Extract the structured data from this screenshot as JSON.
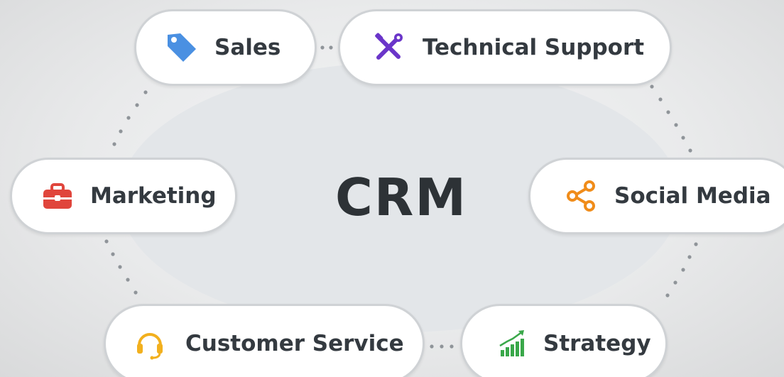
{
  "diagram": {
    "center": {
      "label": "CRM"
    },
    "nodes": [
      {
        "id": "sales",
        "label": "Sales",
        "icon": "tag-icon",
        "color": "#4a90e2"
      },
      {
        "id": "tech",
        "label": "Technical Support",
        "icon": "tools-icon",
        "color": "#6a35c9"
      },
      {
        "id": "marketing",
        "label": "Marketing",
        "icon": "briefcase-icon",
        "color": "#e0453c"
      },
      {
        "id": "social",
        "label": "Social Media",
        "icon": "share-icon",
        "color": "#f08c1a"
      },
      {
        "id": "customer",
        "label": "Customer Service",
        "icon": "headset-icon",
        "color": "#f2b01e"
      },
      {
        "id": "strategy",
        "label": "Strategy",
        "icon": "growth-chart-icon",
        "color": "#3aa84a"
      }
    ],
    "colors": {
      "hub": "#e3e6e9",
      "text": "#343a40",
      "dots": "#8f9499"
    }
  }
}
